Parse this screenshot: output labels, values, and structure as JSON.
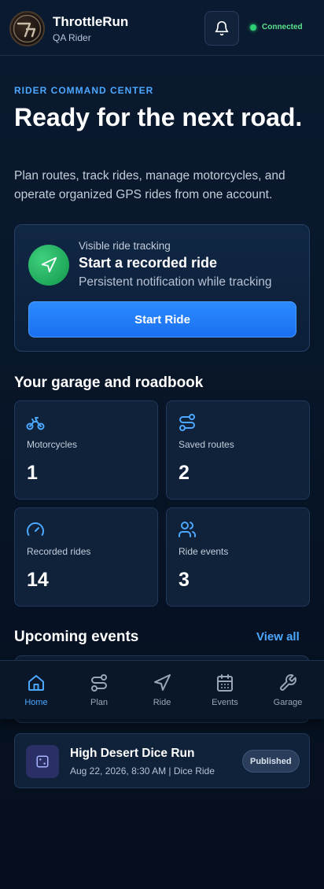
{
  "header": {
    "brand_name": "ThrottleRun",
    "brand_sub": "QA Rider",
    "status": "Connected"
  },
  "hero": {
    "eyebrow": "RIDER COMMAND CENTER",
    "title": "Ready for the next road.",
    "description": "Plan routes, track rides, manage motorcycles, and operate organized GPS rides from one account."
  },
  "ride_card": {
    "kicker": "Visible ride tracking",
    "title": "Start a recorded ride",
    "subtitle": "Persistent notification while tracking",
    "button": "Start Ride"
  },
  "garage": {
    "title": "Your garage and roadbook",
    "stats": [
      {
        "label": "Motorcycles",
        "value": "1",
        "icon": "motorcycle-icon"
      },
      {
        "label": "Saved routes",
        "value": "2",
        "icon": "route-icon"
      },
      {
        "label": "Recorded rides",
        "value": "14",
        "icon": "gauge-icon"
      },
      {
        "label": "Ride events",
        "value": "3",
        "icon": "users-icon"
      }
    ]
  },
  "events": {
    "title": "Upcoming events",
    "view_all": "View all",
    "items": [
      {
        "title": "High Desert Dice Run",
        "meta": "Aug 22, 2026, 8:30 AM | Dice Ride",
        "status": "Published",
        "icon": "dice-icon"
      }
    ]
  },
  "nav": {
    "items": [
      {
        "label": "Home",
        "icon": "home-icon",
        "active": true
      },
      {
        "label": "Plan",
        "icon": "route-icon"
      },
      {
        "label": "Ride",
        "icon": "navigation-icon"
      },
      {
        "label": "Events",
        "icon": "calendar-icon"
      },
      {
        "label": "Garage",
        "icon": "wrench-icon"
      }
    ]
  },
  "colors": {
    "accent": "#4ca8ff",
    "primary_button": "#1a6ff0",
    "connected": "#2fd175",
    "background": "#071325"
  }
}
